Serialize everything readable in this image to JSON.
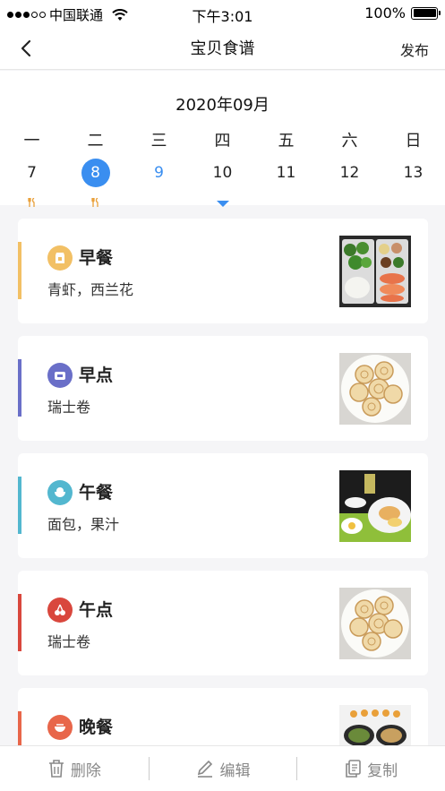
{
  "status_bar": {
    "carrier": "中国联通",
    "time": "下午3:01",
    "battery": "100%"
  },
  "nav": {
    "title": "宝贝食谱",
    "action": "发布"
  },
  "calendar": {
    "month": "2020年09月",
    "weekdays": [
      "一",
      "二",
      "三",
      "四",
      "五",
      "六",
      "日"
    ],
    "days": [
      "7",
      "8",
      "9",
      "10",
      "11",
      "12",
      "13"
    ],
    "selected_day": "8",
    "today": "9",
    "days_with_meals": [
      "7",
      "8"
    ]
  },
  "meals": [
    {
      "name": "早餐",
      "desc": "青虾，西兰花",
      "color": "#f2c065",
      "icon": "bread-bag-icon"
    },
    {
      "name": "早点",
      "desc": "瑞士卷",
      "color": "#6a6fc8",
      "icon": "toast-icon"
    },
    {
      "name": "午餐",
      "desc": "面包，果汁",
      "color": "#53b7cf",
      "icon": "rice-bowl-icon"
    },
    {
      "name": "午点",
      "desc": "瑞士卷",
      "color": "#d9473d",
      "icon": "cherry-icon"
    },
    {
      "name": "晚餐",
      "desc": "",
      "color": "#e8664a",
      "icon": "noodle-bowl-icon"
    }
  ],
  "toolbar": {
    "delete_label": "删除",
    "edit_label": "编辑",
    "copy_label": "复制"
  },
  "colors": {
    "accent": "#3a8ef0"
  }
}
